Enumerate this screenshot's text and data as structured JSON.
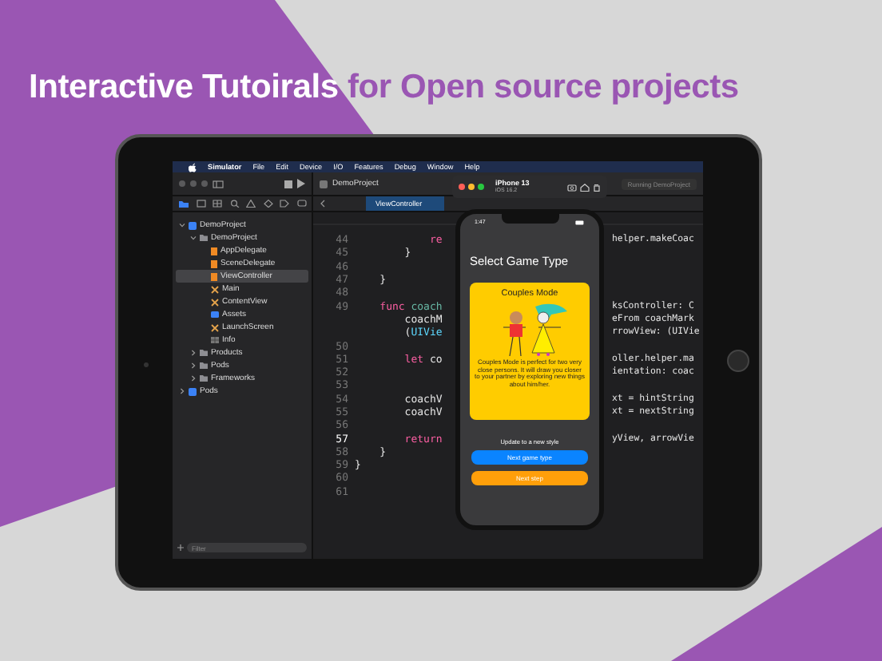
{
  "headline": {
    "lead": "Interactive Tutoirals",
    "rest": "for Open source projects"
  },
  "menu_bar": [
    "Simulator",
    "File",
    "Edit",
    "Device",
    "I/O",
    "Features",
    "Debug",
    "Window",
    "Help"
  ],
  "navigator": {
    "tree": [
      {
        "label": "DemoProject",
        "kind": "project",
        "expanded": true,
        "selected": false,
        "children": [
          {
            "label": "DemoProject",
            "kind": "folder",
            "expanded": true,
            "selected": false,
            "children": [
              {
                "label": "AppDelegate",
                "kind": "swift",
                "selected": false
              },
              {
                "label": "SceneDelegate",
                "kind": "swift",
                "selected": false
              },
              {
                "label": "ViewController",
                "kind": "swift",
                "selected": true
              },
              {
                "label": "Main",
                "kind": "storyboard",
                "selected": false
              },
              {
                "label": "ContentView",
                "kind": "storyboard",
                "selected": false
              },
              {
                "label": "Assets",
                "kind": "assets",
                "selected": false
              },
              {
                "label": "LaunchScreen",
                "kind": "storyboard",
                "selected": false
              },
              {
                "label": "Info",
                "kind": "plist",
                "selected": false
              }
            ]
          },
          {
            "label": "Products",
            "kind": "folder",
            "expanded": false,
            "selected": false
          },
          {
            "label": "Pods",
            "kind": "folder",
            "expanded": false,
            "selected": false
          },
          {
            "label": "Frameworks",
            "kind": "folder",
            "expanded": false,
            "selected": false
          }
        ]
      },
      {
        "label": "Pods",
        "kind": "project",
        "expanded": false,
        "selected": false
      }
    ],
    "filter_placeholder": "Filter"
  },
  "editor": {
    "title": "DemoProject",
    "status": "Running DemoProject",
    "tabs": [
      {
        "label": "ViewController",
        "selected": true
      }
    ],
    "lines": [
      {
        "number": "44",
        "left": [
          {
            "text": "            re",
            "kind": "keyword"
          }
        ],
        "right": "helper.makeCoac"
      },
      {
        "number": "45",
        "left": [
          {
            "text": "        }",
            "kind": "plain"
          }
        ]
      },
      {
        "number": "46"
      },
      {
        "number": "47",
        "left": [
          {
            "text": "    }",
            "kind": "plain"
          }
        ]
      },
      {
        "number": "48"
      },
      {
        "number": "49",
        "left": [
          {
            "text": "    func ",
            "kind": "keyword"
          },
          {
            "text": "coach",
            "kind": "name"
          }
        ],
        "right": "ksController: C"
      },
      {
        "left": [
          {
            "text": "        coachM",
            "kind": "plain"
          }
        ],
        "right": "eFrom coachMark"
      },
      {
        "left": [
          {
            "text": "        (",
            "kind": "plain"
          },
          {
            "text": "UIVie",
            "kind": "type"
          }
        ],
        "right": "rrowView: (UIVie"
      },
      {
        "number": "50"
      },
      {
        "number": "51",
        "left": [
          {
            "text": "        let ",
            "kind": "keyword"
          },
          {
            "text": "co",
            "kind": "plain"
          }
        ],
        "right": "oller.helper.ma"
      },
      {
        "number": "52",
        "right": "ientation: coac"
      },
      {
        "number": "53"
      },
      {
        "number": "54",
        "left": [
          {
            "text": "        coachV",
            "kind": "plain"
          }
        ],
        "right": "xt = hintString"
      },
      {
        "number": "55",
        "left": [
          {
            "text": "        coachV",
            "kind": "plain"
          }
        ],
        "right": "xt = nextString"
      },
      {
        "number": "56"
      },
      {
        "number": "57",
        "left": [
          {
            "text": "        return",
            "kind": "keyword"
          }
        ],
        "right": "yView, arrowVie"
      },
      {
        "number": "58",
        "left": [
          {
            "text": "    }",
            "kind": "plain"
          }
        ]
      },
      {
        "number": "59",
        "left": [
          {
            "text": "}",
            "kind": "plain"
          }
        ]
      },
      {
        "number": "60"
      },
      {
        "number": "61"
      }
    ]
  },
  "simulator": {
    "device": "iPhone 13",
    "os": "iOS 16.2",
    "time": "1:47",
    "heading": "Select Game Type",
    "card": {
      "title": "Couples Mode",
      "description": "Couples Mode is perfect for two very close persons. It will draw you closer to your partner by exploring new things about him/her."
    },
    "hint": "Update to a new style",
    "buttons": [
      {
        "label": "Next game type",
        "kind": "primary"
      },
      {
        "label": "Next step",
        "kind": "secondary"
      }
    ]
  }
}
